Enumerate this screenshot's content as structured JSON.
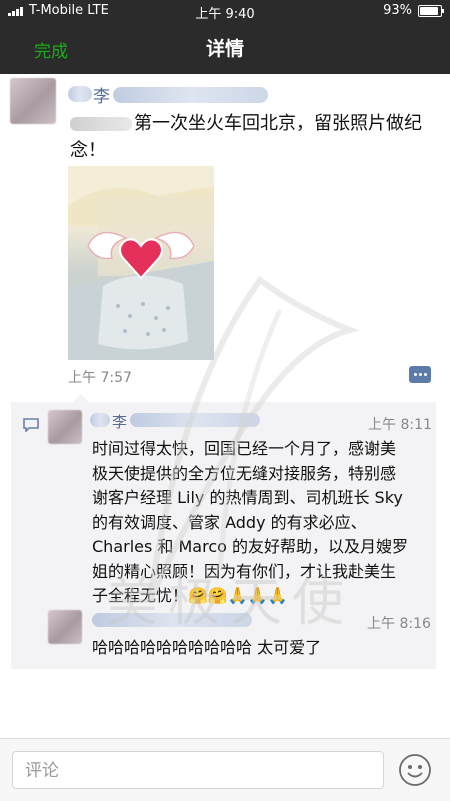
{
  "status_bar": {
    "carrier": "T-Mobile LTE",
    "time": "上午 9:40",
    "battery": "93%",
    "battery_level": 0.93
  },
  "nav": {
    "done_label": "完成",
    "title": "详情"
  },
  "post": {
    "author": "李",
    "text": "第一次坐火车回北京，留张照片做纪念！",
    "time": "上午 7:57",
    "photo_icon": "heart-wings-sticker"
  },
  "comments": [
    {
      "author": "李",
      "time": "上午 8:11",
      "text": "时间过得太快，回国已经一个月了，感谢美极天使提供的全方位无缝对接服务，特别感谢客户经理 Lily 的热情周到、司机班长 Sky 的有效调度、管家 Addy 的有求必应、Charles 和 Marco 的友好帮助，以及月嫂罗姐的精心照顾！因为有你们，才让我赴美生子全程无忧！🤗🤗🙏🙏🙏"
    },
    {
      "author": "",
      "time": "上午 8:16",
      "text": "哈哈哈哈哈哈哈哈哈哈 太可爱了"
    }
  ],
  "watermark": "美极天使",
  "comment_input": {
    "placeholder": "评论"
  },
  "icons": {
    "comment": "comment-bubble-icon",
    "emoji": "emoji-face-icon",
    "more": "more-actions-icon"
  },
  "colors": {
    "nav_bg": "#2b2b2b",
    "done": "#1aad19",
    "name": "#576b95",
    "comment_bg": "#f3f3f5"
  }
}
